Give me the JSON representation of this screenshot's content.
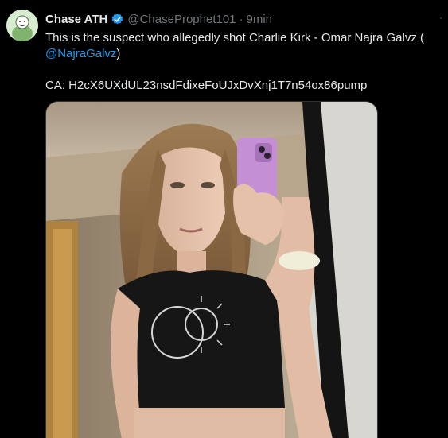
{
  "tweet": {
    "display_name": "Chase ATH",
    "handle": "@ChaseProphet101",
    "separator": "·",
    "time": "9min",
    "text_prefix": "This is the suspect who allegedly shot Charlie Kirk - Omar Najra Galvz (",
    "mention": "@NajraGalvz",
    "text_suffix": ")",
    "ca_line": "CA: H2cX6UXdUL23nsdFdixeFoUJxDvXnj1T7n54ox86pump",
    "more_glyph": "·",
    "verified": true
  },
  "colors": {
    "background": "#000000",
    "text": "#e7e9ea",
    "muted": "#71767b",
    "link": "#1d9bf0",
    "verified_badge": "#1d9bf0"
  },
  "icons": {
    "verified": "verified-badge-icon",
    "more": "more-options-icon"
  },
  "media": {
    "type": "photo",
    "description": "mirror selfie photo"
  }
}
